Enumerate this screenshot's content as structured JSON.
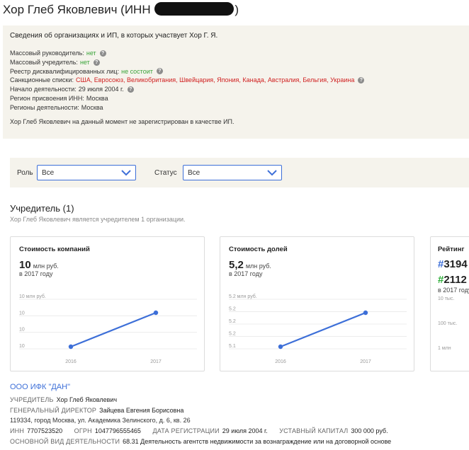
{
  "header": {
    "title_prefix": "Хор Глеб Яковлевич (ИНН",
    "title_suffix": ")"
  },
  "info": {
    "heading": "Сведения об организациях и ИП, в которых участвует Хор Г. Я.",
    "lines": [
      {
        "label": "Массовый руководитель:",
        "value": "нет",
        "tone": "green",
        "help": true
      },
      {
        "label": "Массовый учредитель:",
        "value": "нет",
        "tone": "green",
        "help": true
      },
      {
        "label": "Реестр дисквалифицированных лиц:",
        "value": "не состоит",
        "tone": "green",
        "help": true
      },
      {
        "label": "Санкционные списки:",
        "value": "США, Евросоюз, Великобритания, Швейцария, Япония, Канада, Австралия, Бельгия, Украина",
        "tone": "red",
        "help": true
      },
      {
        "label": "Начало деятельности:",
        "value": "29 июля 2004 г.",
        "tone": "plain",
        "help": true
      },
      {
        "label": "Регион присвоения ИНН:",
        "value": "Москва",
        "tone": "plain",
        "help": false
      },
      {
        "label": "Регионы деятельности:",
        "value": "Москва",
        "tone": "plain",
        "help": false
      }
    ],
    "note": "Хор Глеб Яковлевич на данный момент не зарегистрирован в качестве ИП.",
    "help_glyph": "?"
  },
  "filters": {
    "role_label": "Роль",
    "role_value": "Все",
    "status_label": "Статус",
    "status_value": "Все"
  },
  "founder": {
    "title": "Учредитель (1)",
    "subtitle": "Хор Глеб Яковлевич является учредителем 1 организации."
  },
  "cards": {
    "companies": {
      "title": "Стоимость компаний",
      "value": "10",
      "unit": "млн руб.",
      "year": "в 2017 году"
    },
    "shares": {
      "title": "Стоимость долей",
      "value": "5,2",
      "unit": "млн руб.",
      "year": "в 2017 году"
    },
    "rating": {
      "title": "Рейтинг",
      "value1": "3194",
      "value2": "2112",
      "hash": "#",
      "year": "в 2017 году",
      "ticks": [
        "10 тыс.",
        "100 тыс.",
        "1 млн"
      ]
    }
  },
  "chart_data": [
    {
      "type": "line",
      "title": "Стоимость компаний",
      "x": [
        "2016",
        "2017"
      ],
      "series": [
        {
          "values": [
            10,
            10
          ]
        }
      ],
      "y_ticks": [
        "10 млн руб.",
        "10",
        "10",
        "10"
      ],
      "line_color": "#3d6fd8"
    },
    {
      "type": "line",
      "title": "Стоимость долей",
      "x": [
        "2016",
        "2017"
      ],
      "series": [
        {
          "values": [
            5.1,
            5.2
          ]
        }
      ],
      "y_ticks": [
        "5.2 млн руб.",
        "5.2",
        "5.2",
        "5.2",
        "5.1"
      ],
      "line_color": "#3d6fd8"
    }
  ],
  "org": {
    "name": "ООО ИФК \"ДАН\"",
    "founder_label": "Учредитель",
    "founder_value": "Хор Глеб Яковлевич",
    "director_label": "Генеральный директор",
    "director_value": "Зайцева Евгения Борисовна",
    "address": "119334, город Москва, ул. Академика Зелинского, д. 6, кв. 26",
    "inn_label": "ИНН",
    "inn_value": "7707523520",
    "ogrn_label": "ОГРН",
    "ogrn_value": "1047796555465",
    "reg_label": "Дата регистрации",
    "reg_value": "29 июля 2004 г.",
    "capital_label": "Уставный капитал",
    "capital_value": "300 000 руб.",
    "activity_label": "Основной вид деятельности",
    "activity_value": "68.31 Деятельность агентств недвижимости за вознаграждение или на договорной основе"
  }
}
